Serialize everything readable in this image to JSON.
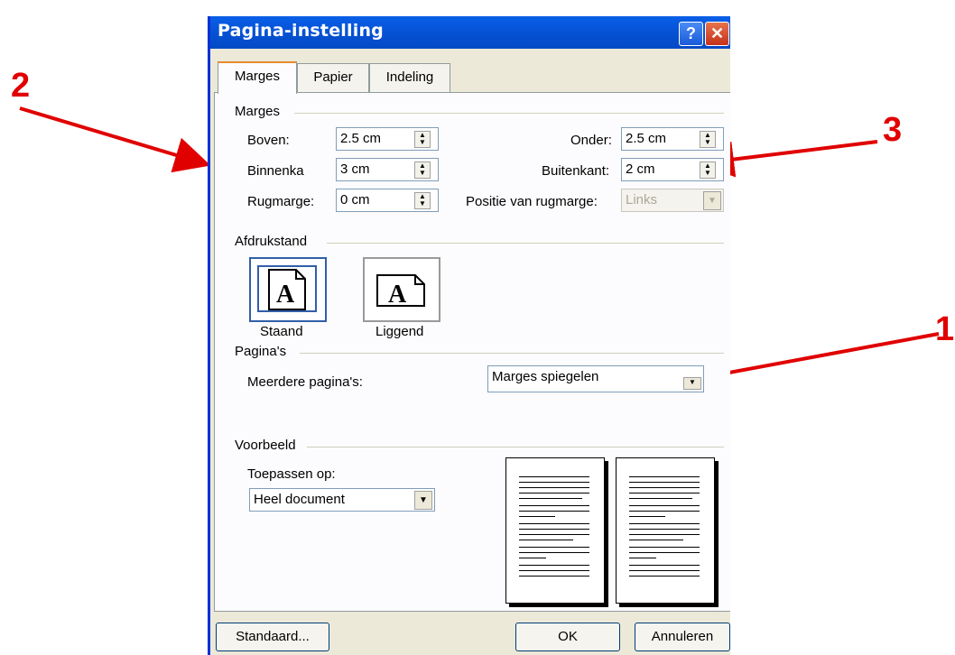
{
  "annotations": {
    "num1": "1",
    "num2": "2",
    "num3": "3",
    "arrow_color": "#e00000"
  },
  "dialog": {
    "title": "Pagina-instelling",
    "help_glyph": "?",
    "close_glyph": "✕",
    "tabs": [
      "Marges",
      "Papier",
      "Indeling"
    ],
    "active_tab": "Marges"
  },
  "marges": {
    "group_label": "Marges",
    "boven_label": "Boven:",
    "boven_value": "2.5 cm",
    "onder_label": "Onder:",
    "onder_value": "2.5 cm",
    "binnenka_label": "Binnenka",
    "binnenka_value": "3 cm",
    "buitenkant_label": "Buitenkant:",
    "buitenkant_value": "2 cm",
    "rugmarge_label": "Rugmarge:",
    "rugmarge_value": "0 cm",
    "positie_label": "Positie van rugmarge:",
    "positie_value": "Links"
  },
  "afdrukstand": {
    "group_label": "Afdrukstand",
    "staand_label": "Staand",
    "liggend_label": "Liggend",
    "glyph": "A",
    "selected": "Staand"
  },
  "paginas": {
    "group_label": "Pagina's",
    "meerdere_label": "Meerdere pagina's:",
    "meerdere_value": "Marges spiegelen"
  },
  "voorbeeld": {
    "group_label": "Voorbeeld",
    "toepassen_label": "Toepassen op:",
    "toepassen_value": "Heel document"
  },
  "buttons": {
    "standaard": "Standaard...",
    "ok": "OK",
    "annuleren": "Annuleren"
  }
}
